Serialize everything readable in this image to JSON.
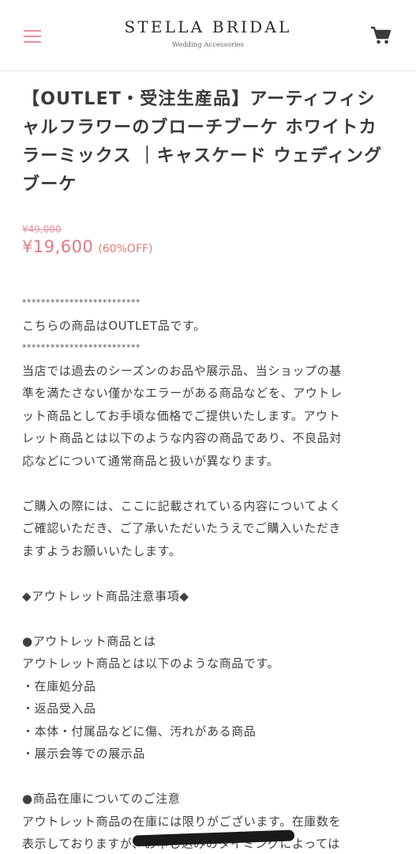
{
  "header": {
    "brand_name": "STELLA BRIDAL",
    "brand_subtitle": "Wedding Accessories",
    "menu_icon": "hamburger-menu-icon",
    "cart_icon": "shopping-cart-icon",
    "accent_color": "#e8919a"
  },
  "product": {
    "title": "【OUTLET・受注生産品】アーティフィシャルフラワーのブローチブーケ ホワイトカラーミックス ｜キャスケード ウェディングブーケ",
    "original_price": "¥49,000",
    "price": "¥19,600",
    "discount": "(60%OFF)",
    "price_color": "#e07a82"
  },
  "description": {
    "stars_top": "*************************",
    "outlet_notice": "こちらの商品はOUTLET品です。",
    "stars_bottom": "*************************",
    "para1": [
      "当店では過去のシーズンのお品や展示品、当ショップの基",
      "準を満たさない僅かなエラーがある商品などを、アウトレ",
      "ット商品としてお手頃な価格でご提供いたします。アウト",
      "レット商品とは以下のような内容の商品であり、不良品対",
      "応などについて通常商品と扱いが異なります。"
    ],
    "para2": [
      "ご購入の際には、ここに記載されている内容についてよく",
      "ご確認いただき、ご了承いただいたうえでご購入いただき",
      "ますようお願いいたします。"
    ],
    "section_heading": "◆アウトレット商品注意事項◆",
    "subheading1": "●アウトレット商品とは",
    "intro1": "アウトレット商品とは以下のような商品です。",
    "items": [
      "・在庫処分品",
      "・返品受入品",
      "・本体・付属品などに傷、汚れがある商品",
      "・展示会等での展示品"
    ],
    "subheading2": "●商品在庫についてのご注意",
    "stock_lines": [
      "アウトレット商品の在庫には限りがございます。在庫数を",
      "表示しておりますが、お申し込みのタイミングによっては"
    ]
  }
}
